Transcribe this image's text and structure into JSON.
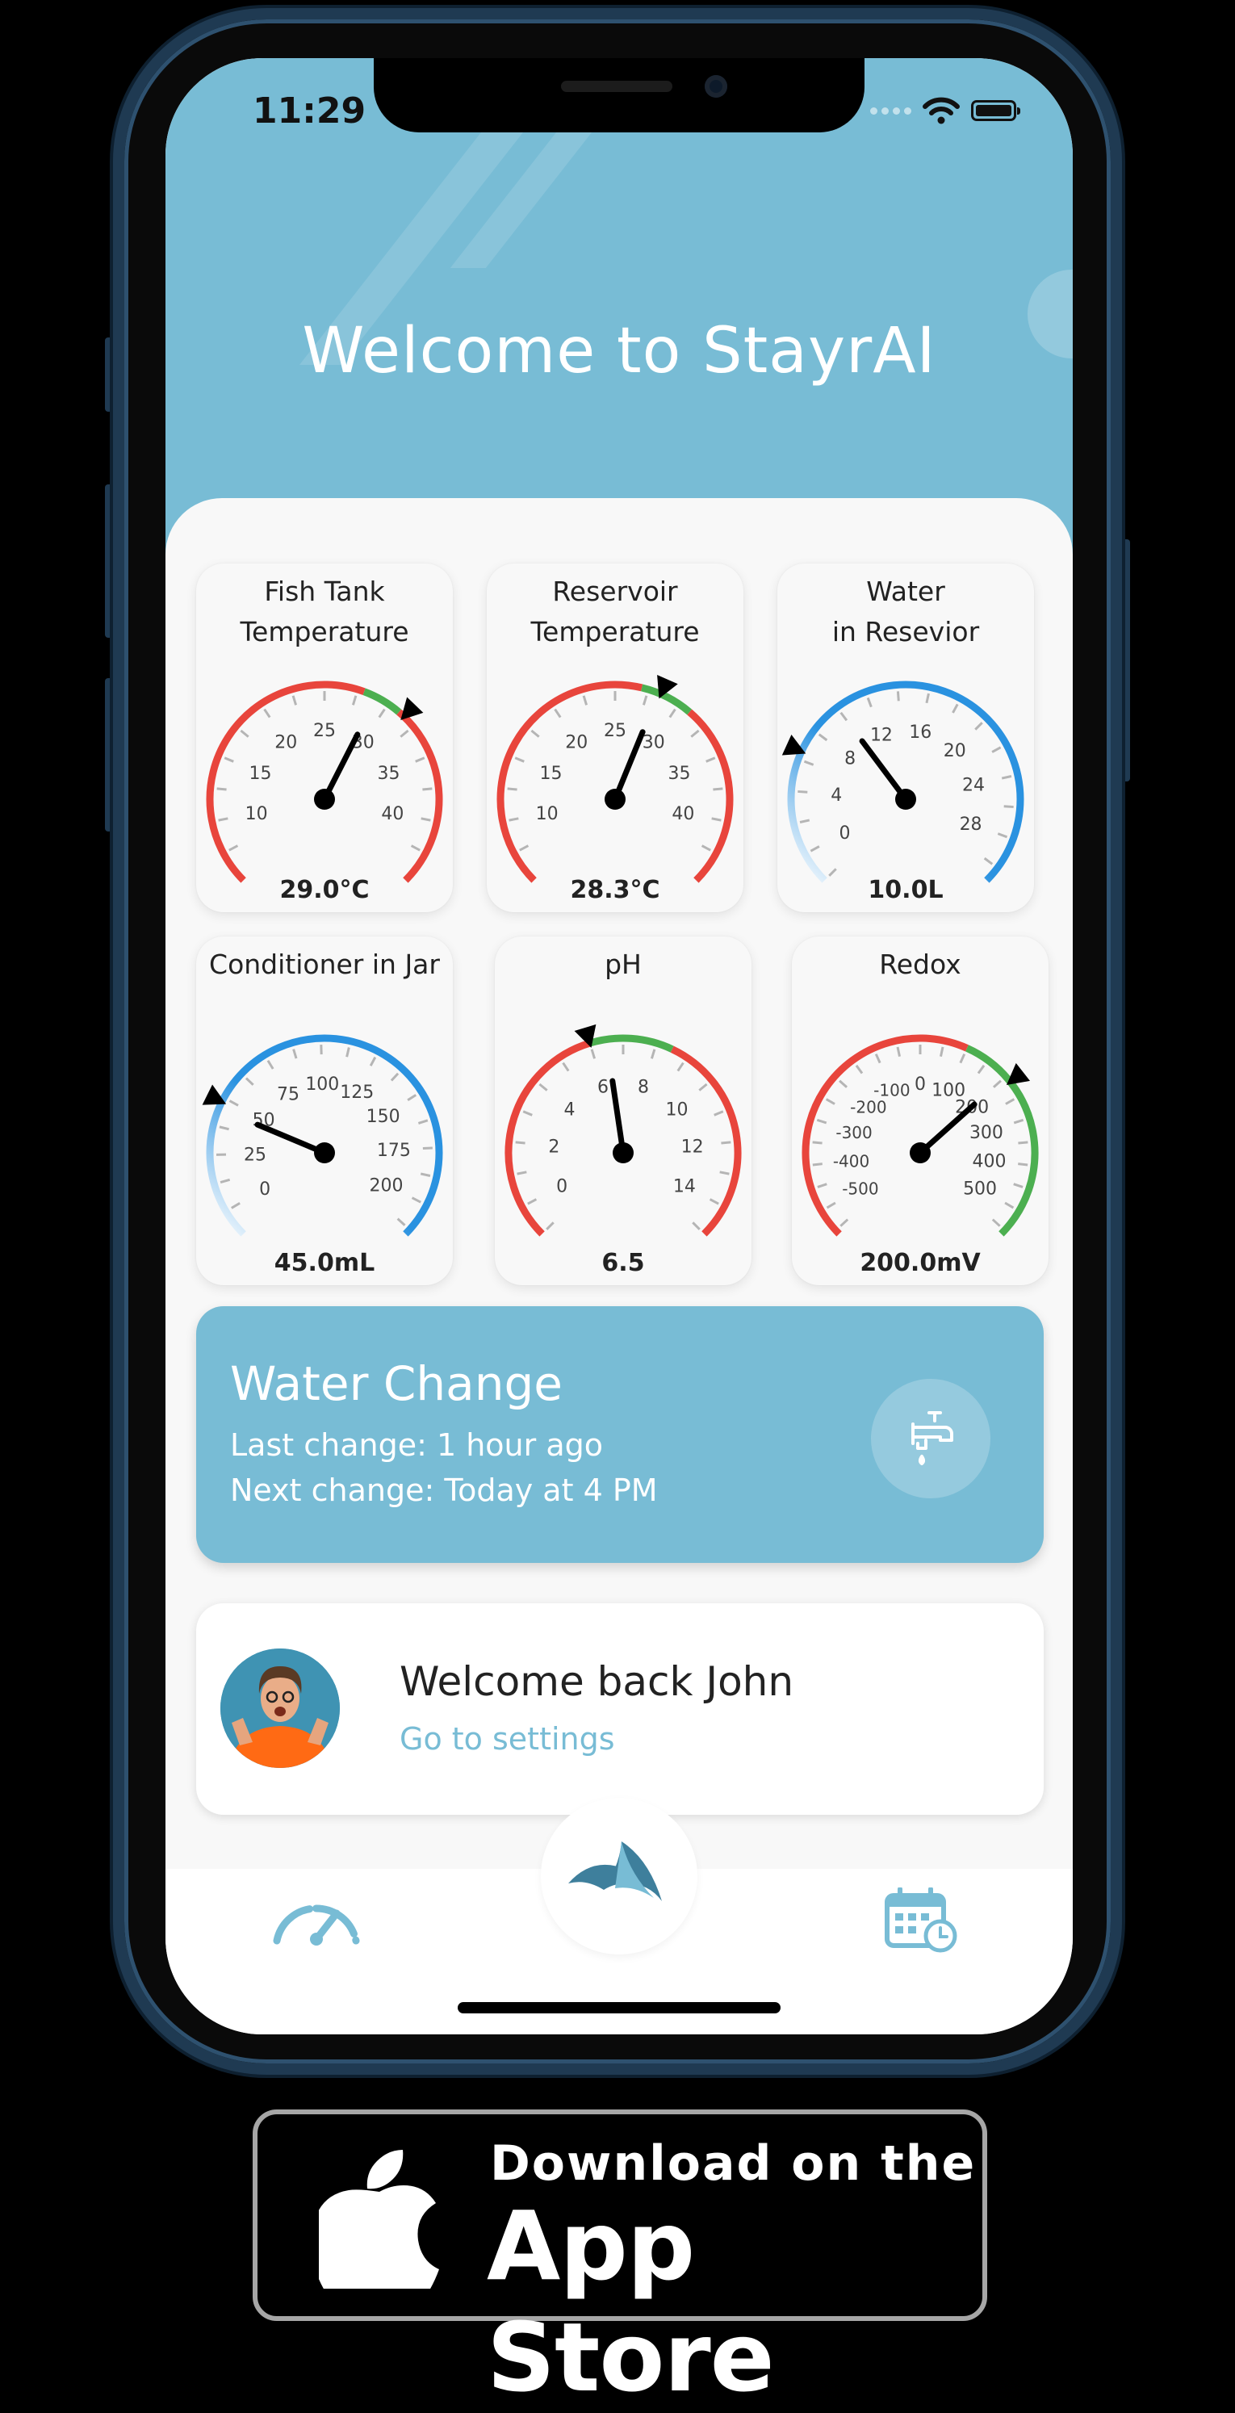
{
  "status_bar": {
    "time": "11:29"
  },
  "header": {
    "title": "Welcome to StayrAI"
  },
  "gauges": [
    {
      "title_lines": [
        "Fish Tank",
        "Temperature"
      ],
      "value": 29.0,
      "value_label": "29.0°C",
      "min": 5,
      "max": 45,
      "ticks": [
        "10",
        "15",
        "20",
        "25",
        "30",
        "35",
        "40"
      ],
      "tick_values": [
        10,
        15,
        20,
        25,
        30,
        35,
        40
      ],
      "marker_value": 31.5,
      "ranges": [
        {
          "from": 5,
          "to": 28,
          "color": "#e8453c"
        },
        {
          "from": 28,
          "to": 31,
          "color": "#4caf50"
        },
        {
          "from": 31,
          "to": 45,
          "color": "#e8453c"
        }
      ]
    },
    {
      "title_lines": [
        "Reservoir",
        "Temperature"
      ],
      "value": 28.3,
      "value_label": "28.3°C",
      "min": 5,
      "max": 45,
      "ticks": [
        "10",
        "15",
        "20",
        "25",
        "30",
        "35",
        "40"
      ],
      "tick_values": [
        10,
        15,
        20,
        25,
        30,
        35,
        40
      ],
      "marker_value": 28.5,
      "ranges": [
        {
          "from": 5,
          "to": 27,
          "color": "#e8453c"
        },
        {
          "from": 27,
          "to": 31,
          "color": "#4caf50"
        },
        {
          "from": 31,
          "to": 45,
          "color": "#e8453c"
        }
      ]
    },
    {
      "title_lines": [
        "Water",
        "in Resevior"
      ],
      "value": 10.0,
      "value_label": "10.0L",
      "min": -2,
      "max": 31,
      "ticks": [
        "0",
        "4",
        "8",
        "12",
        "16",
        "20",
        "24",
        "28"
      ],
      "tick_values": [
        0,
        4,
        8,
        12,
        16,
        20,
        24,
        28
      ],
      "marker_value": 6.5,
      "ranges": [
        {
          "from": -2,
          "to": 31,
          "color": "#2a92e0",
          "gradient": true
        }
      ]
    },
    {
      "title_lines": [
        "Conditioner in Jar"
      ],
      "value": 45.0,
      "value_label": "45.0mL",
      "min": -12,
      "max": 215,
      "ticks": [
        "0",
        "25",
        "50",
        "75",
        "100",
        "125",
        "150",
        "175",
        "200"
      ],
      "tick_values": [
        0,
        25,
        50,
        75,
        100,
        125,
        150,
        175,
        200
      ],
      "marker_value": 48,
      "ranges": [
        {
          "from": -12,
          "to": 215,
          "color": "#2a92e0",
          "gradient": true
        }
      ]
    },
    {
      "title_lines": [
        "pH"
      ],
      "value": 6.5,
      "value_label": "6.5",
      "min": -1,
      "max": 15,
      "ticks": [
        "0",
        "2",
        "4",
        "6",
        "8",
        "10",
        "12",
        "14"
      ],
      "tick_values": [
        0,
        2,
        4,
        6,
        8,
        10,
        12,
        14
      ],
      "marker_value": 6.0,
      "ranges": [
        {
          "from": -1,
          "to": 6,
          "color": "#e8453c"
        },
        {
          "from": 6,
          "to": 8.5,
          "color": "#4caf50"
        },
        {
          "from": 8.5,
          "to": 15,
          "color": "#e8453c"
        }
      ]
    },
    {
      "title_lines": [
        "Redox"
      ],
      "value": 200.0,
      "value_label": "200.0mV",
      "min": -560,
      "max": 560,
      "ticks": [
        "-500",
        "-400",
        "-300",
        "-200",
        "-100",
        "0",
        "100",
        "200",
        "300",
        "400",
        "500"
      ],
      "tick_values": [
        -500,
        -400,
        -300,
        -200,
        -100,
        0,
        100,
        200,
        300,
        400,
        500
      ],
      "marker_value": 215,
      "ranges": [
        {
          "from": -560,
          "to": 100,
          "color": "#e8453c"
        },
        {
          "from": 100,
          "to": 560,
          "color": "#4caf50"
        }
      ]
    }
  ],
  "water_change": {
    "title": "Water Change",
    "last_change": "Last change: 1 hour ago",
    "next_change": "Next change: Today at 4 PM"
  },
  "user": {
    "greeting": "Welcome back John",
    "settings_link": "Go to settings"
  },
  "nav": {
    "items": [
      "gauge-icon",
      "stayrai-logo-icon",
      "calendar-clock-icon"
    ]
  },
  "app_store_badge": {
    "line1": "Download on the",
    "line2": "App Store"
  },
  "colors": {
    "accent": "#78bcd5",
    "red": "#e8453c",
    "green": "#4caf50",
    "blue": "#2a92e0"
  }
}
